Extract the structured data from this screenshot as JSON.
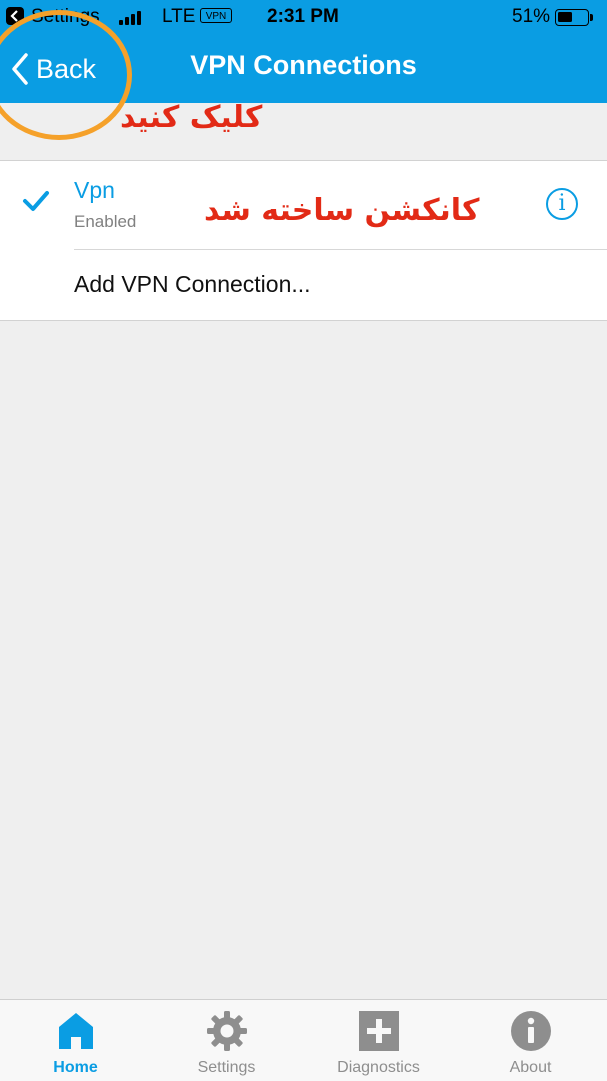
{
  "status_bar": {
    "app_name": "Settings",
    "carrier": "LTE",
    "vpn_badge": "VPN",
    "time": "2:31 PM",
    "battery": "51%",
    "battery_level": 0.51
  },
  "nav": {
    "back_label": "Back",
    "title": "VPN Connections"
  },
  "annotations": {
    "click_hint": "کلیک کنید",
    "created_hint": "کانکشن ساخته شد"
  },
  "connections": {
    "vpn_name": "Vpn",
    "vpn_status": "Enabled",
    "add_label": "Add VPN Connection..."
  },
  "tabs": [
    {
      "label": "Home",
      "icon": "home-icon",
      "active": true
    },
    {
      "label": "Settings",
      "icon": "gear-icon",
      "active": false
    },
    {
      "label": "Diagnostics",
      "icon": "plus-box-icon",
      "active": false
    },
    {
      "label": "About",
      "icon": "info-circle-icon",
      "active": false
    }
  ],
  "colors": {
    "accent": "#0a9de3",
    "annotation_text": "#e22a16",
    "annotation_ring": "#f5a12a"
  }
}
